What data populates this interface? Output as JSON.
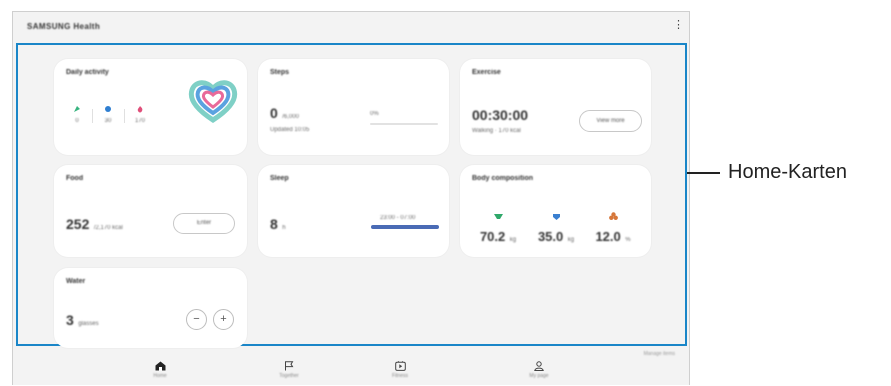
{
  "app": {
    "title": "SAMSUNG Health",
    "menu_icon": "more-vertical-icon"
  },
  "callout": {
    "label": "Home-Karten"
  },
  "cards": {
    "daily_activity": {
      "title": "Daily activity",
      "metrics": [
        {
          "icon": "steps-icon",
          "color": "#36b37e",
          "value": "0"
        },
        {
          "icon": "active-time-icon",
          "color": "#2f7fd1",
          "value": "30"
        },
        {
          "icon": "calories-icon",
          "color": "#e04f7a",
          "value": "170"
        }
      ],
      "ring_colors": [
        "#7fd0c6",
        "#5aa2e0",
        "#e86a9a"
      ]
    },
    "steps": {
      "title": "Steps",
      "value": "0",
      "unit": "/6,000",
      "subtitle": "Updated 10:05",
      "progress_label": "0%",
      "progress": 0
    },
    "exercise": {
      "title": "Exercise",
      "value": "00:30:00",
      "subtitle": "Walking · 170 kcal",
      "button": "View more"
    },
    "food": {
      "title": "Food",
      "value": "252",
      "unit": "/2,170 kcal",
      "button": "Enter"
    },
    "sleep": {
      "title": "Sleep",
      "value": "8",
      "unit": "h",
      "range_label": "23:00 - 07:00",
      "bar_color": "#4a6bb5"
    },
    "body_composition": {
      "title": "Body composition",
      "metrics": [
        {
          "icon": "weight-icon",
          "color": "#2fa86a",
          "value": "70.2",
          "unit": "kg"
        },
        {
          "icon": "muscle-icon",
          "color": "#3a7fd0",
          "value": "35.0",
          "unit": "kg"
        },
        {
          "icon": "body-fat-icon",
          "color": "#d6773a",
          "value": "12.0",
          "unit": "%"
        }
      ]
    },
    "water": {
      "title": "Water",
      "value": "3",
      "unit": "glasses",
      "minus": "−",
      "plus": "+"
    }
  },
  "footer": {
    "note": "Manage items"
  },
  "nav": [
    {
      "icon": "home-icon",
      "label": "Home"
    },
    {
      "icon": "flag-icon",
      "label": "Together"
    },
    {
      "icon": "fitness-play-icon",
      "label": "Fitness"
    },
    {
      "icon": "profile-icon",
      "label": "My page"
    }
  ]
}
